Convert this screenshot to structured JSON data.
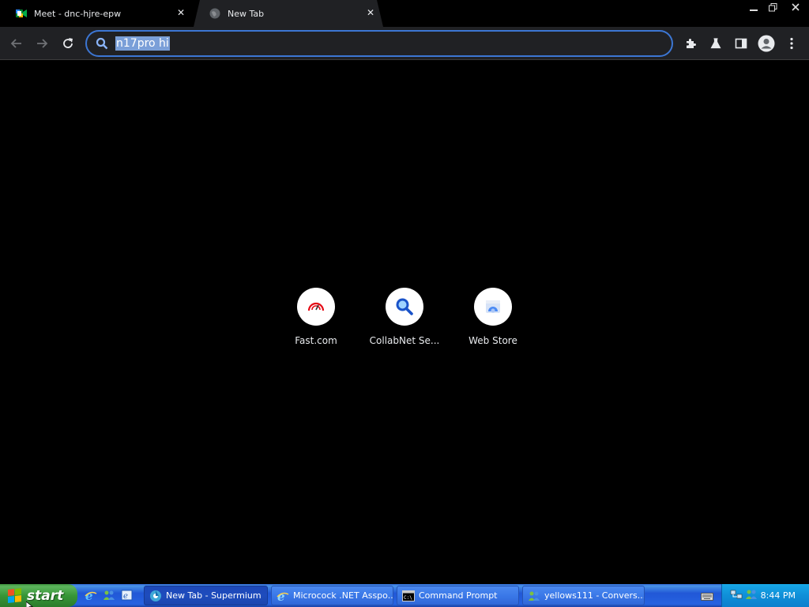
{
  "tabs": [
    {
      "title": "Meet - dnc-hjre-epw",
      "icon": "google-meet-icon",
      "active": false
    },
    {
      "title": "New Tab",
      "icon": "globe-icon",
      "active": true
    }
  ],
  "toolbar": {
    "omnibox_value": "n17pro hi"
  },
  "shortcuts": [
    {
      "label": "Fast.com",
      "icon": "speedometer-icon"
    },
    {
      "label": "CollabNet Se...",
      "icon": "magnifier-icon"
    },
    {
      "label": "Web Store",
      "icon": "web-store-icon"
    }
  ],
  "taskbar": {
    "start_label": "start",
    "buttons": [
      {
        "label": "New Tab - Supermium",
        "icon": "supermium-icon",
        "active": true
      },
      {
        "label": "Microcock .NET Asspo...",
        "icon": "ie-icon",
        "active": false
      },
      {
        "label": "Command Prompt",
        "icon": "cmd-icon",
        "active": false
      },
      {
        "label": "yellows111 - Convers...",
        "icon": "messenger-icon",
        "active": false
      }
    ],
    "clock": "8:44 PM"
  },
  "colors": {
    "accent": "#3c76d3",
    "toolbar_bg": "#202124",
    "taskbar_blue": "#2157d7",
    "start_green": "#379637"
  }
}
